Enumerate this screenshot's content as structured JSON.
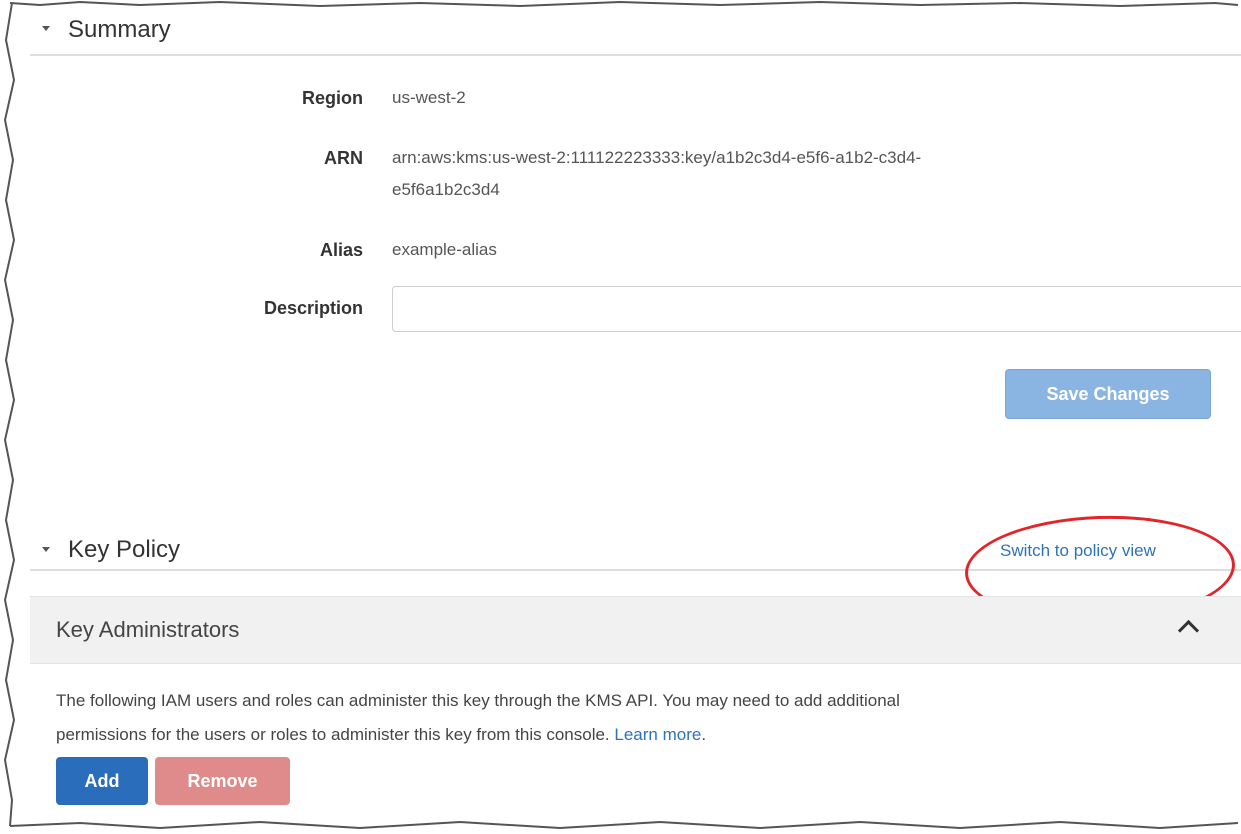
{
  "summary": {
    "title": "Summary",
    "fields": {
      "region": {
        "label": "Region",
        "value": "us-west-2"
      },
      "arn": {
        "label": "ARN",
        "value_line1": "arn:aws:kms:us-west-2:111122223333:key/a1b2c3d4-e5f6-a1b2-c3d4-",
        "value_line2": "e5f6a1b2c3d4"
      },
      "alias": {
        "label": "Alias",
        "value": "example-alias"
      },
      "description": {
        "label": "Description",
        "value": ""
      }
    },
    "save_label": "Save Changes"
  },
  "key_policy": {
    "title": "Key Policy",
    "switch_link": "Switch to policy view",
    "highlight_color": "#e0262a"
  },
  "key_administrators": {
    "title": "Key Administrators",
    "text_line1": "The following IAM users and roles can administer this key through the KMS API. You may need to add additional",
    "text_line2": "permissions for the users or roles to administer this key from this console.",
    "learn_more": "Learn more",
    "learn_more_suffix": ".",
    "add_label": "Add",
    "remove_label": "Remove"
  },
  "colors": {
    "link": "#2e73b8",
    "save_button": "#8ab5e3",
    "add_button": "#2a6ebb",
    "remove_button": "#e08b8b",
    "annotation": "#e0262a"
  }
}
